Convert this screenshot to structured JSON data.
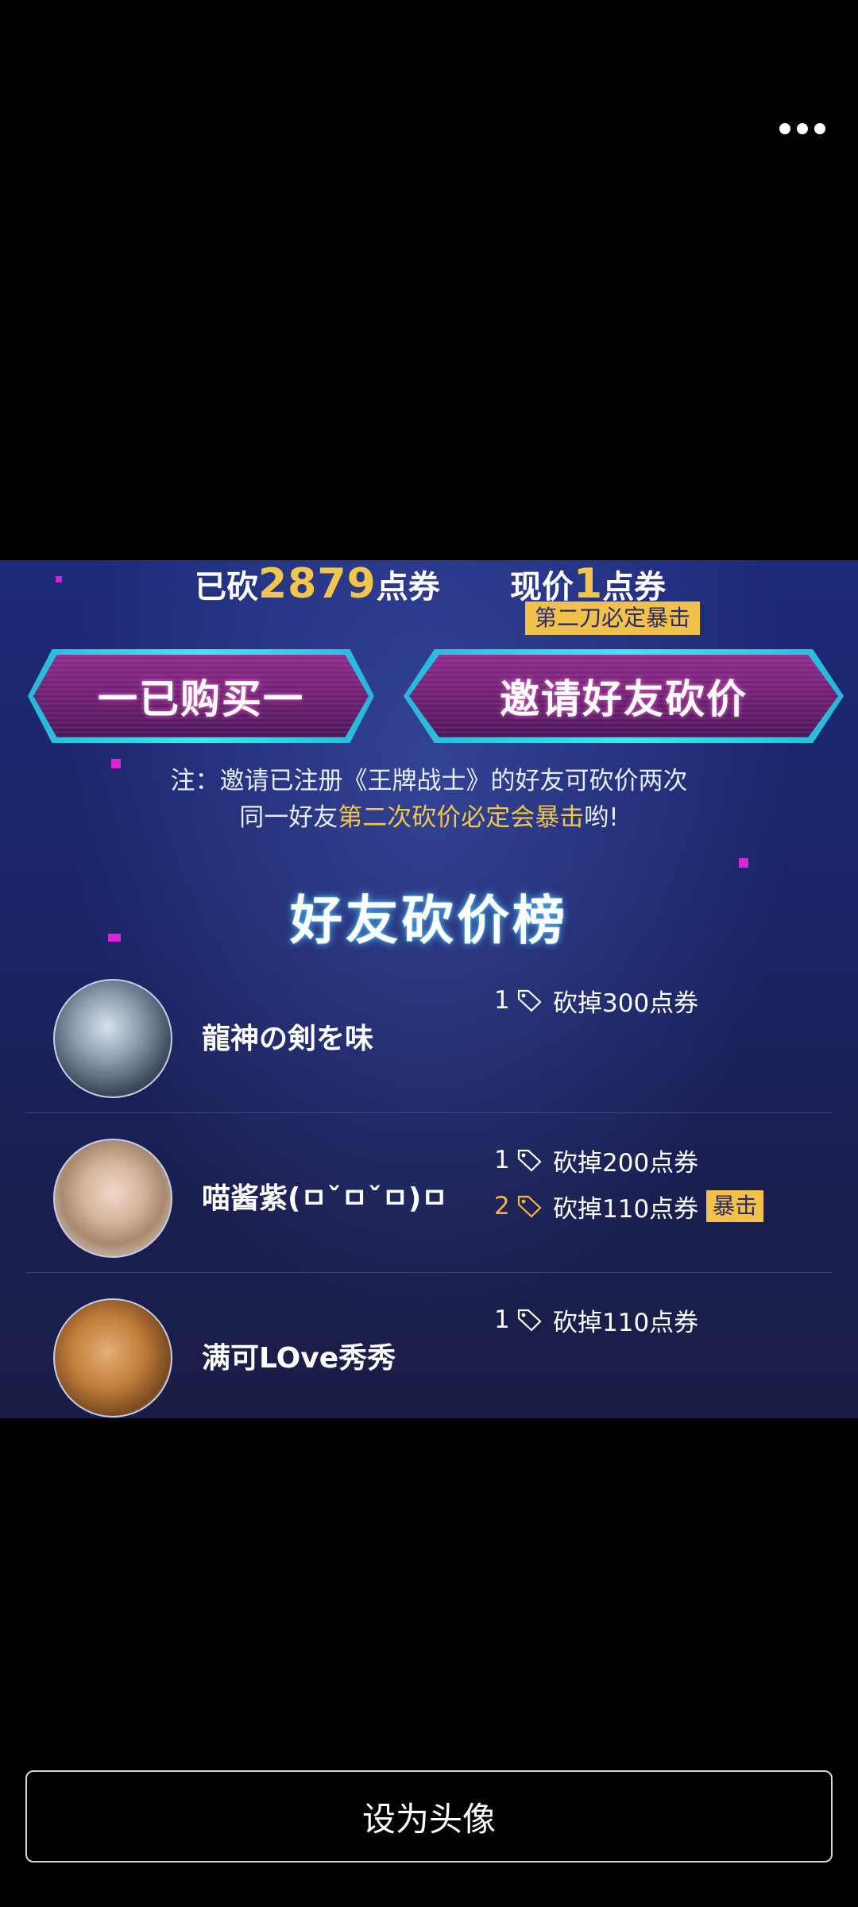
{
  "viewer": {
    "set_avatar_label": "设为头像"
  },
  "image": {
    "price": {
      "cut_prefix": "已砍",
      "cut_amount": "2879",
      "cut_unit": "点券",
      "now_prefix": "现价",
      "now_amount": "1",
      "now_unit": "点券",
      "crit_tag": "第二刀必定暴击"
    },
    "buttons": {
      "bought": "一已购买一",
      "invite": "邀请好友砍价"
    },
    "note": {
      "line1": "注：邀请已注册《王牌战士》的好友可砍价两次",
      "line2_prefix": "同一好友",
      "line2_highlight": "第二次砍价必定会暴击",
      "line2_suffix": "哟!"
    },
    "rank_title": "好友砍价榜",
    "friends": [
      {
        "name": "龍神の剣を味",
        "cuts": [
          {
            "index": "1",
            "text": "砍掉300点券",
            "crit": false
          }
        ]
      },
      {
        "name": "喵酱紫(ㅁˇㅁˇㅁ)ㅁ",
        "cuts": [
          {
            "index": "1",
            "text": "砍掉200点券",
            "crit": false
          },
          {
            "index": "2",
            "text": "砍掉110点券",
            "crit": true,
            "badge": "暴击"
          }
        ]
      },
      {
        "name": "满可LOve秀秀",
        "cuts": [
          {
            "index": "1",
            "text": "砍掉110点券",
            "crit": false
          }
        ]
      }
    ]
  },
  "colors": {
    "accent_gold": "#f1c64a",
    "button_frame": "#46e4f2",
    "button_fill": "#7a2378",
    "background": "#000000"
  },
  "icons": {
    "more": "more-dots-icon",
    "coupon": "coupon-tag-icon"
  }
}
